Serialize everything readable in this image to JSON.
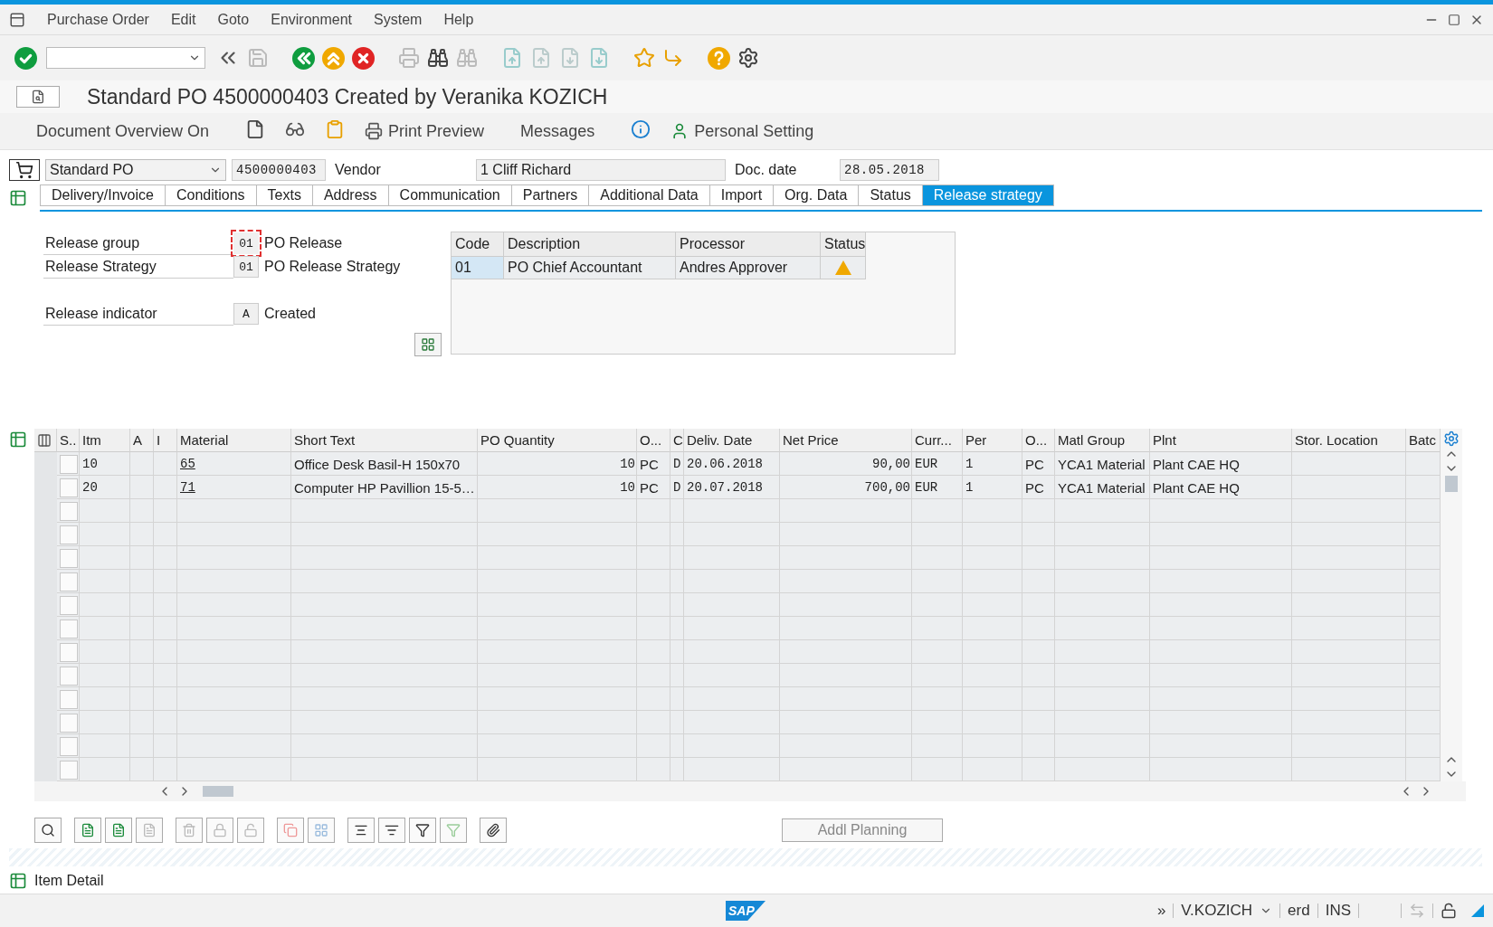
{
  "menu": [
    "Purchase Order",
    "Edit",
    "Goto",
    "Environment",
    "System",
    "Help"
  ],
  "title": "Standard PO 4500000403 Created by Veranika KOZICH",
  "app_toolbar": [
    {
      "kind": "text",
      "label": "Document Overview On"
    },
    {
      "kind": "icon"
    },
    {
      "kind": "icon"
    },
    {
      "kind": "icon"
    },
    {
      "kind": "icon_text",
      "label": "Print Preview"
    },
    {
      "kind": "text",
      "label": "Messages"
    },
    {
      "kind": "icon"
    },
    {
      "kind": "icon_text",
      "label": "Personal Setting"
    }
  ],
  "header": {
    "doc_type": "Standard PO",
    "po_number": "4500000403",
    "vendor_label": "Vendor",
    "vendor": "1 Cliff Richard",
    "doc_date_label": "Doc. date",
    "doc_date": "28.05.2018"
  },
  "tabs": [
    {
      "label": "Delivery/Invoice",
      "selected": false
    },
    {
      "label": "Conditions",
      "selected": false
    },
    {
      "label": "Texts",
      "selected": false
    },
    {
      "label": "Address",
      "selected": false
    },
    {
      "label": "Communication",
      "selected": false
    },
    {
      "label": "Partners",
      "selected": false
    },
    {
      "label": "Additional Data",
      "selected": false
    },
    {
      "label": "Import",
      "selected": false
    },
    {
      "label": "Org. Data",
      "selected": false
    },
    {
      "label": "Status",
      "selected": false
    },
    {
      "label": "Release strategy",
      "selected": true
    }
  ],
  "release_fields": [
    {
      "label": "Release group",
      "code": "01",
      "text": "PO Release",
      "focused": true
    },
    {
      "label": "Release Strategy",
      "code": "01",
      "text": "PO Release Strategy",
      "focused": false
    },
    {
      "label": "Release indicator",
      "code": "A",
      "text": "Created",
      "focused": false
    }
  ],
  "release_table": {
    "columns": [
      "Code",
      "Description",
      "Processor",
      "Status"
    ],
    "rows": [
      {
        "code": "01",
        "description": "PO Chief Accountant",
        "processor": "Andres Approver"
      }
    ]
  },
  "items_table": {
    "columns": [
      "S..",
      "Itm",
      "A",
      "I",
      "Material",
      "Short Text",
      "PO Quantity",
      "O...",
      "C",
      "Deliv. Date",
      "Net Price",
      "Curr...",
      "Per",
      "O...",
      "Matl Group",
      "Plnt",
      "Stor. Location",
      "Batc"
    ],
    "rows": [
      {
        "selected": false,
        "itm": "10",
        "material": "65",
        "short_text": "Office Desk Basil-H 150x70",
        "quantity": "10",
        "unit": "PC",
        "c": "D",
        "date": "20.06.2018",
        "price": "90,00",
        "currency": "EUR",
        "per": "1",
        "price_unit": "PC",
        "matl_group": "YCA1 Material",
        "plant": "Plant CAE HQ"
      },
      {
        "selected": false,
        "itm": "20",
        "material": "71",
        "short_text": "Computer HP Pavillion 15-5…",
        "quantity": "10",
        "unit": "PC",
        "c": "D",
        "date": "20.07.2018",
        "price": "700,00",
        "currency": "EUR",
        "per": "1",
        "price_unit": "PC",
        "matl_group": "YCA1 Material",
        "plant": "Plant CAE HQ"
      },
      {
        "selected": false
      },
      {
        "selected": false
      },
      {
        "selected": false
      },
      {
        "selected": false
      },
      {
        "selected": false
      },
      {
        "selected": false
      },
      {
        "selected": false
      },
      {
        "selected": false
      },
      {
        "selected": false
      },
      {
        "selected": false
      },
      {
        "selected": false
      },
      {
        "selected": false
      }
    ]
  },
  "addl_planning": {
    "label": "Addl Planning",
    "disabled": true
  },
  "item_detail": "Item Detail",
  "logo": "SAP",
  "status_bar": [
    "»",
    "V.KOZICH",
    "erd",
    "INS"
  ]
}
